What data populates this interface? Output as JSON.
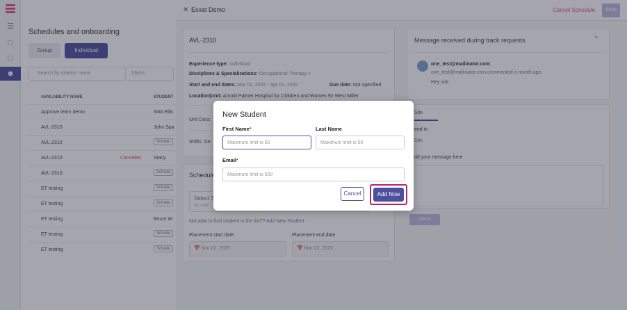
{
  "sidebar": {
    "icons": [
      "logo-icon",
      "menu-icon",
      "document-icon",
      "document-icon",
      "users-icon"
    ]
  },
  "page": {
    "title": "Schedules and onboarding",
    "tabs": {
      "group": "Group",
      "individual": "Individual"
    },
    "search_placeholder": "Search by rotation name",
    "status_filter": "Status",
    "columns": {
      "name": "AVAILABILITY NAME",
      "student": "STUDENT"
    },
    "rows": [
      {
        "name": "Approve team demo",
        "status": "",
        "student": "Matt Ellis"
      },
      {
        "name": "AVL-2310",
        "status": "",
        "student": "John Spa"
      },
      {
        "name": "AVL-2310",
        "status": "",
        "student": "Schedu"
      },
      {
        "name": "AVL-2310",
        "status": "Canceled",
        "student": "Stacy"
      },
      {
        "name": "AVL-2310",
        "status": "",
        "student": "Schedu"
      },
      {
        "name": "ET testing",
        "status": "",
        "student": "Schedu"
      },
      {
        "name": "ET testing",
        "status": "",
        "student": "Schedu"
      },
      {
        "name": "ET testing",
        "status": "",
        "student": "Bruce W"
      },
      {
        "name": "ET testing",
        "status": "",
        "student": "Schedu"
      },
      {
        "name": "ET testing",
        "status": "",
        "student": "Schedu"
      }
    ]
  },
  "panel": {
    "title": "Exxat Demo",
    "cancel_schedule": "Cancel Schedule",
    "save": "Save",
    "card": {
      "title": "AVL-2310",
      "experience_label": "Experience type:",
      "experience_value": "Individual",
      "disciplines_label": "Disciplines & Specializations:",
      "disciplines_value": "Occupational Therapy",
      "dates_label": "Start and end dates:",
      "dates_value": "Mar 01, 2025 - Apr 01, 2025",
      "due_label": "Due date:",
      "due_value": "Not specified",
      "location_label": "Location|Unit:",
      "location_value": "Arnold Palmer Hospital for Children and Women 92 West Miller",
      "unit_desc": "Unit Desc",
      "shifts": "Shifts: Ge"
    },
    "schedule": {
      "title": "Schedule",
      "select_label": "Select S",
      "select_sub": "No stud",
      "not_found": "Not able to find student in the list??",
      "add_new": "Add New Student",
      "start_label": "Placement start date",
      "start_value": "Mar 02, 2025",
      "end_label": "Placement end date",
      "end_value": "Mar 22, 2025"
    },
    "messages": {
      "title": "Message received during track requests",
      "email": "one_test@mailinator.com",
      "meta": "one_test@mailinator.com commented a month ago",
      "body": "Hey site",
      "tab": "Site",
      "send_to": "end to",
      "site": "Site",
      "add_message": "dd your message here",
      "send": "Send"
    }
  },
  "modal": {
    "title": "New Student",
    "first_name_label": "First Name",
    "last_name_label": "Last Name",
    "email_label": "Email",
    "required_mark": "*",
    "first_name_placeholder": "Maximum limit is 50",
    "last_name_placeholder": "Maximum limit is 50",
    "email_placeholder": "Maximum limit is 500",
    "cancel": "Cancel",
    "add_now": "Add Now"
  },
  "colors": {
    "primary": "#4b4f9e",
    "accent": "#e0507a",
    "highlight": "#b8226a"
  }
}
